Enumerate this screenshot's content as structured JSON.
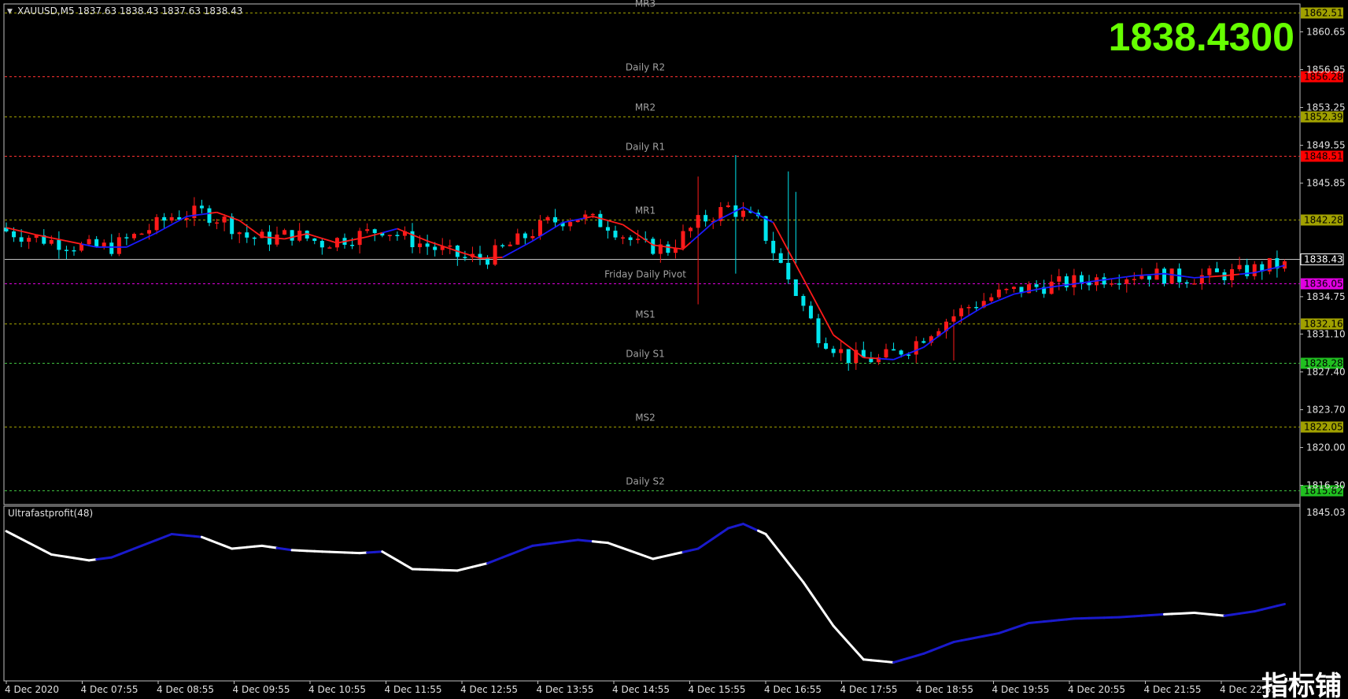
{
  "header": {
    "symbol_line": "XAUUSD,M5  1837.63 1838.43 1837.63 1838.43",
    "big_price": "1838.4300"
  },
  "indicator": {
    "title": "Ultrafastprofit(48)",
    "axis_label": "1845.03"
  },
  "colors": {
    "background": "#000000",
    "bull": "#ff1a1a",
    "bear": "#00e5ee",
    "ma_up": "#1a1aff",
    "ma_down": "#ff1a1a",
    "big_price": "#66ff00",
    "red_level": "#ff3030",
    "olive_level": "#a0a000",
    "green_level": "#40c040",
    "magenta_level": "#e000e0",
    "gray_level": "#c0c0c0"
  },
  "levels": [
    {
      "label": "MR3",
      "price": 1862.51,
      "tag": "1862.51",
      "kind": "olive"
    },
    {
      "label": "Daily R2",
      "price": 1856.28,
      "tag": "1856.28",
      "kind": "red"
    },
    {
      "label": "MR2",
      "price": 1852.39,
      "tag": "1852.39",
      "kind": "olive"
    },
    {
      "label": "Daily R1",
      "price": 1848.51,
      "tag": "1848.51",
      "kind": "red"
    },
    {
      "label": "MR1",
      "price": 1842.28,
      "tag": "1842.28",
      "kind": "olive"
    },
    {
      "label": "",
      "price": 1838.43,
      "tag": "1838.43",
      "kind": "current"
    },
    {
      "label": "Friday  Daily Pivot",
      "price": 1836.05,
      "tag": "1836.05",
      "kind": "magenta"
    },
    {
      "label": "MS1",
      "price": 1832.16,
      "tag": "1832.16",
      "kind": "olive"
    },
    {
      "label": "Daily S1",
      "price": 1828.28,
      "tag": "1828.28",
      "kind": "green"
    },
    {
      "label": "MS2",
      "price": 1822.05,
      "tag": "1822.05",
      "kind": "olive"
    },
    {
      "label": "Daily S2",
      "price": 1815.82,
      "tag": "1815.82",
      "kind": "green"
    }
  ],
  "price_axis": [
    "1860.65",
    "1856.95",
    "1853.25",
    "1849.55",
    "1845.85",
    "1834.75",
    "1831.10",
    "1827.40",
    "1823.70",
    "1820.00",
    "1816.30"
  ],
  "time_axis": [
    "4 Dec 2020",
    "4 Dec 07:55",
    "4 Dec 08:55",
    "4 Dec 09:55",
    "4 Dec 10:55",
    "4 Dec 11:55",
    "4 Dec 12:55",
    "4 Dec 13:55",
    "4 Dec 14:55",
    "4 Dec 15:55",
    "4 Dec 16:55",
    "4 Dec 17:55",
    "4 Dec 18:55",
    "4 Dec 19:55",
    "4 Dec 20:55",
    "4 Dec 21:55",
    "4 Dec 22:55"
  ],
  "chart_data": {
    "type": "candlestick",
    "price_range": [
      1814.5,
      1863.3
    ],
    "ma_path": [
      [
        0,
        1841.5
      ],
      [
        4,
        1840.8
      ],
      [
        8,
        1840.2
      ],
      [
        12,
        1839.6
      ],
      [
        16,
        1839.6
      ],
      [
        20,
        1841.0
      ],
      [
        24,
        1842.6
      ],
      [
        28,
        1843.0
      ],
      [
        31,
        1842.2
      ],
      [
        34,
        1840.6
      ],
      [
        37,
        1840.4
      ],
      [
        40,
        1840.9
      ],
      [
        44,
        1840.0
      ],
      [
        48,
        1840.6
      ],
      [
        52,
        1841.4
      ],
      [
        56,
        1840.2
      ],
      [
        60,
        1839.2
      ],
      [
        63,
        1838.5
      ],
      [
        66,
        1838.6
      ],
      [
        70,
        1840.2
      ],
      [
        74,
        1842.0
      ],
      [
        78,
        1842.6
      ],
      [
        82,
        1841.8
      ],
      [
        86,
        1839.8
      ],
      [
        90,
        1839.4
      ],
      [
        94,
        1842.0
      ],
      [
        98,
        1843.5
      ],
      [
        102,
        1842.0
      ],
      [
        106,
        1836.5
      ],
      [
        110,
        1831.0
      ],
      [
        114,
        1828.8
      ],
      [
        118,
        1828.6
      ],
      [
        122,
        1829.8
      ],
      [
        126,
        1832.0
      ],
      [
        130,
        1833.8
      ],
      [
        134,
        1835.0
      ],
      [
        138,
        1835.6
      ],
      [
        142,
        1836.0
      ],
      [
        146,
        1836.4
      ],
      [
        150,
        1836.8
      ],
      [
        154,
        1837.0
      ],
      [
        158,
        1836.6
      ],
      [
        162,
        1836.8
      ],
      [
        166,
        1837.1
      ],
      [
        170,
        1837.8
      ]
    ],
    "ma_color_switch": [
      [
        0,
        "down"
      ],
      [
        10,
        "up"
      ],
      [
        27,
        "down"
      ],
      [
        50,
        "up"
      ],
      [
        52,
        "down"
      ],
      [
        66,
        "up"
      ],
      [
        77,
        "down"
      ],
      [
        91,
        "up"
      ],
      [
        102,
        "down"
      ],
      [
        116,
        "up"
      ],
      [
        160,
        "down"
      ],
      [
        164,
        "up"
      ]
    ],
    "indicator_path": [
      [
        0,
        1
      ],
      [
        6,
        0.84
      ],
      [
        11,
        0.8
      ],
      [
        14,
        0.82
      ],
      [
        18,
        0.9
      ],
      [
        22,
        0.98
      ],
      [
        26,
        0.96
      ],
      [
        30,
        0.88
      ],
      [
        34,
        0.9
      ],
      [
        38,
        0.87
      ],
      [
        42,
        0.86
      ],
      [
        47,
        0.85
      ],
      [
        50,
        0.86
      ],
      [
        54,
        0.74
      ],
      [
        60,
        0.73
      ],
      [
        64,
        0.78
      ],
      [
        70,
        0.9
      ],
      [
        76,
        0.94
      ],
      [
        80,
        0.92
      ],
      [
        86,
        0.81
      ],
      [
        92,
        0.88
      ],
      [
        96,
        1.02
      ],
      [
        98,
        1.05
      ],
      [
        101,
        0.98
      ],
      [
        106,
        0.65
      ],
      [
        110,
        0.35
      ],
      [
        114,
        0.12
      ],
      [
        118,
        0.1
      ],
      [
        122,
        0.16
      ],
      [
        126,
        0.24
      ],
      [
        132,
        0.3
      ],
      [
        136,
        0.37
      ],
      [
        142,
        0.4
      ],
      [
        148,
        0.41
      ],
      [
        154,
        0.43
      ],
      [
        158,
        0.44
      ],
      [
        162,
        0.42
      ],
      [
        166,
        0.45
      ],
      [
        170,
        0.5
      ]
    ],
    "indicator_switch": [
      [
        0,
        "white"
      ],
      [
        12,
        "blue"
      ],
      [
        26,
        "white"
      ],
      [
        36,
        "blue"
      ],
      [
        38,
        "white"
      ],
      [
        48,
        "blue"
      ],
      [
        50,
        "white"
      ],
      [
        64,
        "blue"
      ],
      [
        78,
        "white"
      ],
      [
        90,
        "blue"
      ],
      [
        100,
        "white"
      ],
      [
        118,
        "blue"
      ],
      [
        154,
        "white"
      ],
      [
        162,
        "blue"
      ]
    ],
    "candle_count": 171
  }
}
